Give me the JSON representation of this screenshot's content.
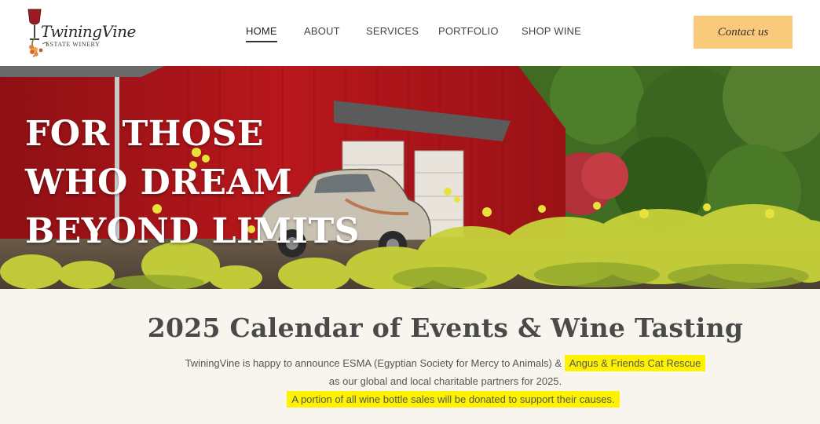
{
  "brand": {
    "name": "TwiningVine",
    "tagline": "ESTATE WINERY"
  },
  "nav": {
    "items": [
      {
        "label": "HOME",
        "active": true
      },
      {
        "label": "ABOUT",
        "active": false
      },
      {
        "label": "SERVICES",
        "active": false
      },
      {
        "label": "PORTFOLIO",
        "active": false
      },
      {
        "label": "SHOP WINE",
        "active": false
      }
    ],
    "contact_label": "Contact us"
  },
  "hero": {
    "lines": [
      "FOR THOSE",
      "WHO DREAM",
      "BEYOND LIMITS"
    ]
  },
  "events": {
    "title": "2025 Calendar of Events & Wine Tasting",
    "line1_prefix": "TwiningVine is happy to announce ESMA (Egyptian Society for Mercy to Animals) &",
    "line1_highlight": "Angus & Friends Cat Rescue",
    "line2": "as our global and local charitable partners for 2025.",
    "line3_highlight": "A portion of all wine bottle sales will be donated to support their causes."
  },
  "colors": {
    "accent_button": "#f9c97c",
    "highlight": "#fff200",
    "barn_red": "#b3161b",
    "section_bg": "#f8f5ef"
  },
  "icons": {
    "logo": "wine-glass-grapes-icon"
  }
}
